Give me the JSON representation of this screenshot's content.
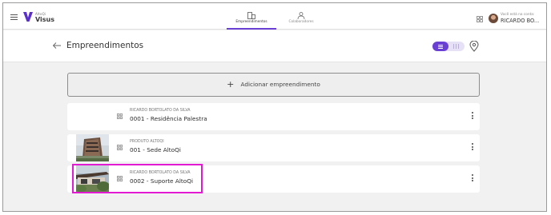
{
  "app": {
    "brand_small": "AltoQi",
    "brand": "Visus"
  },
  "nav": {
    "tabs": [
      {
        "label": "Empreendimentos",
        "icon": "building-icon",
        "active": true
      },
      {
        "label": "Colaboradores",
        "icon": "people-icon",
        "active": false
      }
    ]
  },
  "account": {
    "label": "Você está na conta:",
    "name": "RICARDO BO..."
  },
  "header": {
    "title": "Empreendimentos"
  },
  "add_button": {
    "label": "Adicionar empreendimento"
  },
  "projects": [
    {
      "client": "RICARDO BORTOLATO DA SILVA",
      "name": "0001 - Residência Palestra",
      "has_image": false
    },
    {
      "client": "PRODUTO ALTOQI",
      "name": "001 - Sede AltoQi",
      "has_image": true,
      "image": "building-photo"
    },
    {
      "client": "RICARDO BORTOLATO DA SILVA",
      "name": "0002 - Suporte AltoQi",
      "has_image": true,
      "image": "house-photo",
      "highlighted": true
    }
  ],
  "colors": {
    "accent": "#6a3fd4",
    "highlight": "#e21bd3",
    "background": "#f1f1f1"
  }
}
